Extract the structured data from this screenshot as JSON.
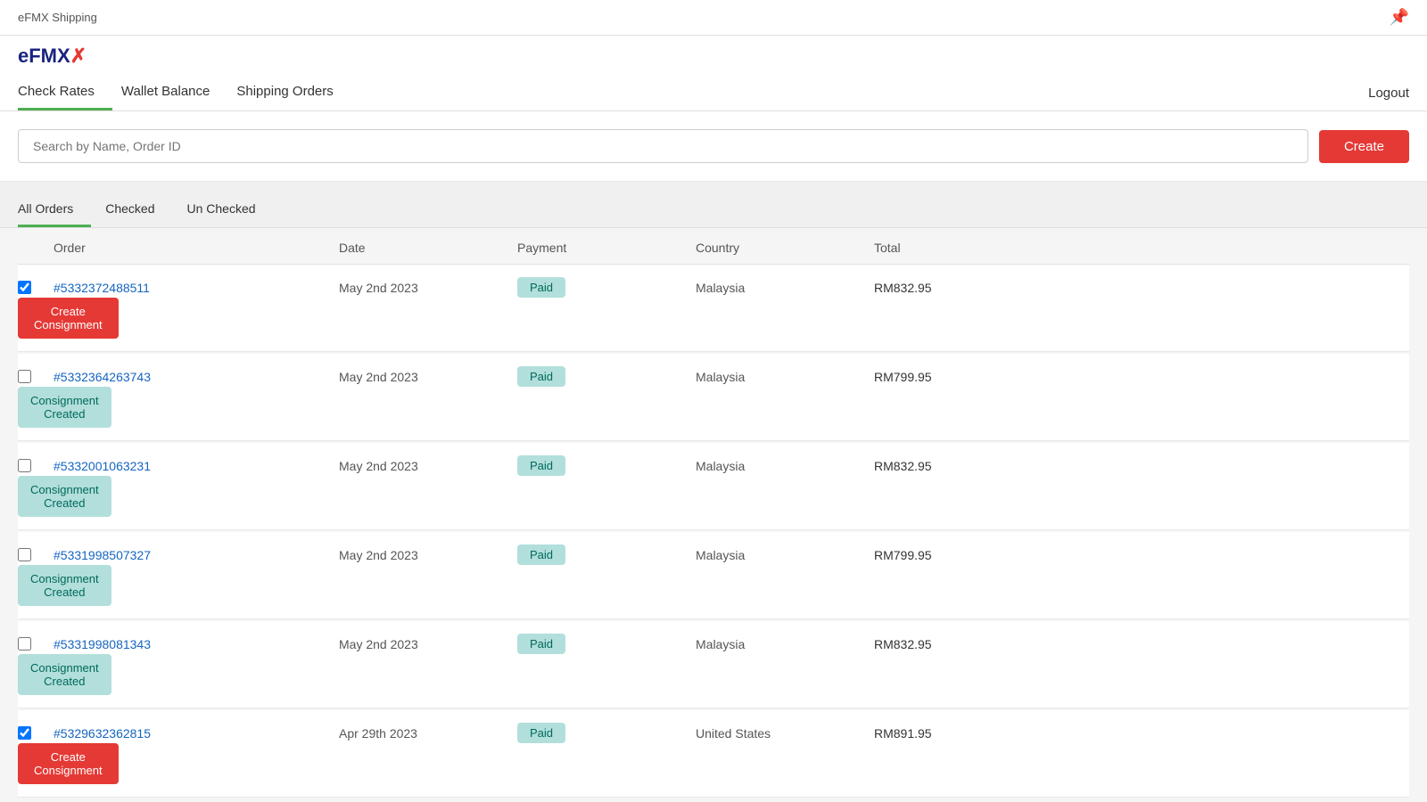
{
  "topbar": {
    "title": "eFMX Shipping",
    "pin_icon": "📌"
  },
  "logo": {
    "text_main": "eFMX",
    "text_x": "✕"
  },
  "nav": {
    "items": [
      {
        "label": "Check Rates",
        "active": true
      },
      {
        "label": "Wallet Balance",
        "active": false
      },
      {
        "label": "Shipping Orders",
        "active": false
      }
    ],
    "logout_label": "Logout"
  },
  "search": {
    "placeholder": "Search by Name, Order ID",
    "create_label": "Create"
  },
  "tabs": [
    {
      "label": "All Orders",
      "active": true
    },
    {
      "label": "Checked",
      "active": false
    },
    {
      "label": "Un Checked",
      "active": false
    }
  ],
  "table": {
    "headers": [
      "",
      "Order",
      "Date",
      "Payment",
      "Country",
      "Total",
      ""
    ],
    "rows": [
      {
        "order_id": "#5332372488511",
        "date": "May 2nd 2023",
        "payment": "Paid",
        "country": "Malaysia",
        "total": "RM832.95",
        "action": "Create Consignment",
        "action_type": "create",
        "checked": true
      },
      {
        "order_id": "#5332364263743",
        "date": "May 2nd 2023",
        "payment": "Paid",
        "country": "Malaysia",
        "total": "RM799.95",
        "action": "Consignment Created",
        "action_type": "created",
        "checked": false
      },
      {
        "order_id": "#5332001063231",
        "date": "May 2nd 2023",
        "payment": "Paid",
        "country": "Malaysia",
        "total": "RM832.95",
        "action": "Consignment Created",
        "action_type": "created",
        "checked": false
      },
      {
        "order_id": "#5331998507327",
        "date": "May 2nd 2023",
        "payment": "Paid",
        "country": "Malaysia",
        "total": "RM799.95",
        "action": "Consignment Created",
        "action_type": "created",
        "checked": false
      },
      {
        "order_id": "#5331998081343",
        "date": "May 2nd 2023",
        "payment": "Paid",
        "country": "Malaysia",
        "total": "RM832.95",
        "action": "Consignment Created",
        "action_type": "created",
        "checked": false
      },
      {
        "order_id": "#5329632362815",
        "date": "Apr 29th 2023",
        "payment": "Paid",
        "country": "United States",
        "total": "RM891.95",
        "action": "Create Consignment",
        "action_type": "create",
        "checked": true
      }
    ]
  }
}
